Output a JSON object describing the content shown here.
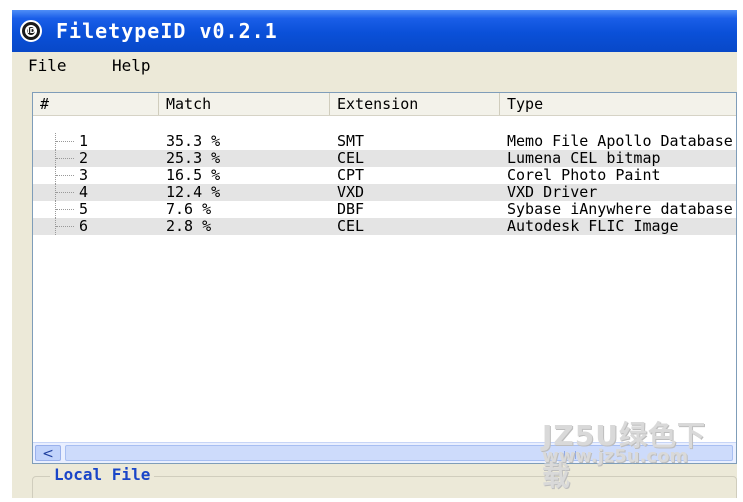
{
  "window": {
    "title": "FiletypeID v0.2.1",
    "icon_text": "ID"
  },
  "menu": {
    "file": "File",
    "help": "Help"
  },
  "list": {
    "columns": [
      "#",
      "Match",
      "Extension",
      "Type"
    ],
    "rows": [
      {
        "num": "1",
        "match": "35.3 %",
        "ext": "SMT",
        "type": "Memo File Apollo Database"
      },
      {
        "num": "2",
        "match": "25.3 %",
        "ext": "CEL",
        "type": "Lumena CEL bitmap"
      },
      {
        "num": "3",
        "match": "16.5 %",
        "ext": "CPT",
        "type": "Corel Photo Paint"
      },
      {
        "num": "4",
        "match": "12.4 %",
        "ext": "VXD",
        "type": "VXD Driver"
      },
      {
        "num": "5",
        "match": "7.6 %",
        "ext": "DBF",
        "type": "Sybase iAnywhere database"
      },
      {
        "num": "6",
        "match": "2.8 %",
        "ext": "CEL",
        "type": "Autodesk FLIC Image"
      }
    ]
  },
  "scroll": {
    "left_arrow": "<"
  },
  "group": {
    "label": "Local File"
  },
  "watermark": {
    "line1": "JZ5U绿色下载",
    "line2": "www.jz5u.com"
  },
  "colors": {
    "title_bar": "#0a50d8",
    "window_face": "#ece9d8",
    "group_label": "#1a46c8",
    "alt_row": "#e4e4e4"
  }
}
